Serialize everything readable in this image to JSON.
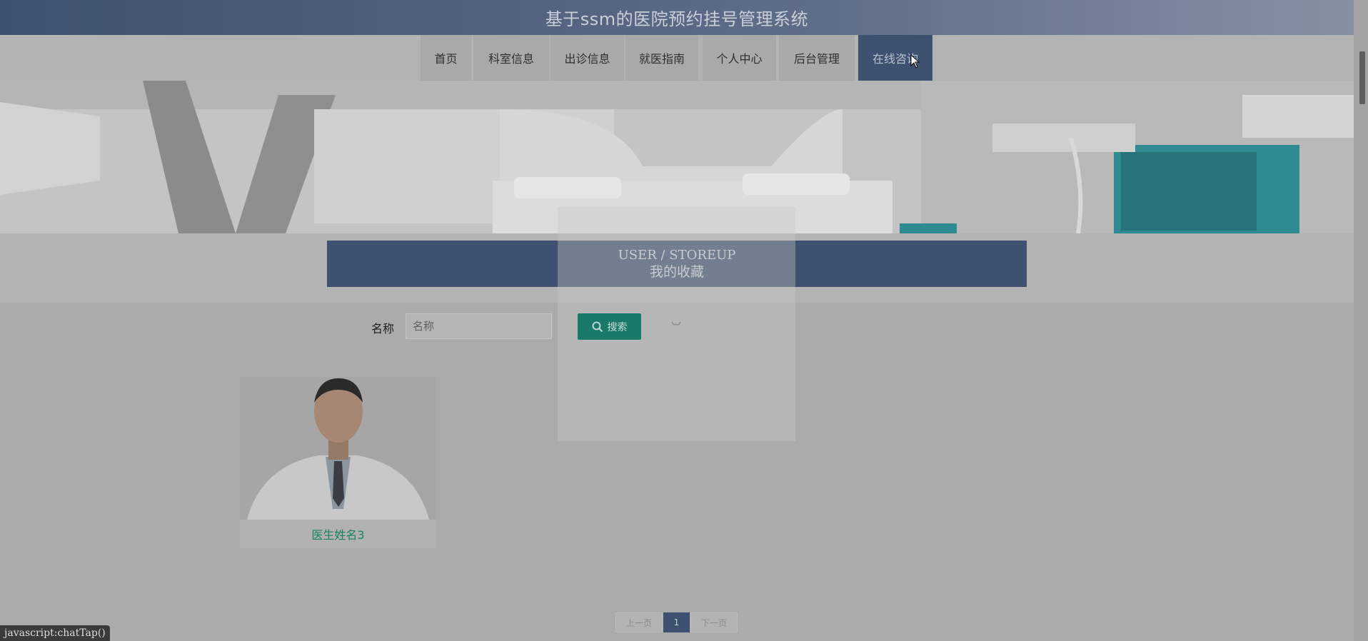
{
  "header": {
    "title": "基于ssm的医院预约挂号管理系统"
  },
  "nav": {
    "items": [
      {
        "label": "首页"
      },
      {
        "label": "科室信息"
      },
      {
        "label": "出诊信息"
      },
      {
        "label": "就医指南"
      },
      {
        "label": "个人中心"
      },
      {
        "label": "后台管理"
      },
      {
        "label": "在线咨询",
        "active": true
      }
    ]
  },
  "section": {
    "title_en": "USER / STOREUP",
    "title_cn": "我的收藏"
  },
  "search": {
    "label": "名称",
    "placeholder": "名称",
    "value": "",
    "button_label": "搜索"
  },
  "cards": [
    {
      "name": "医生姓名3"
    }
  ],
  "pagination": {
    "prev_label": "上一页",
    "next_label": "下一页",
    "current_page": "1"
  },
  "status_bar": {
    "text": "javascript:chatTap()"
  },
  "colors": {
    "primary": "#3f5170",
    "accent": "#1a7a6a",
    "link": "#1a8262"
  },
  "icons": [
    "search-icon",
    "loading-spinner-icon",
    "mouse-cursor-icon"
  ]
}
